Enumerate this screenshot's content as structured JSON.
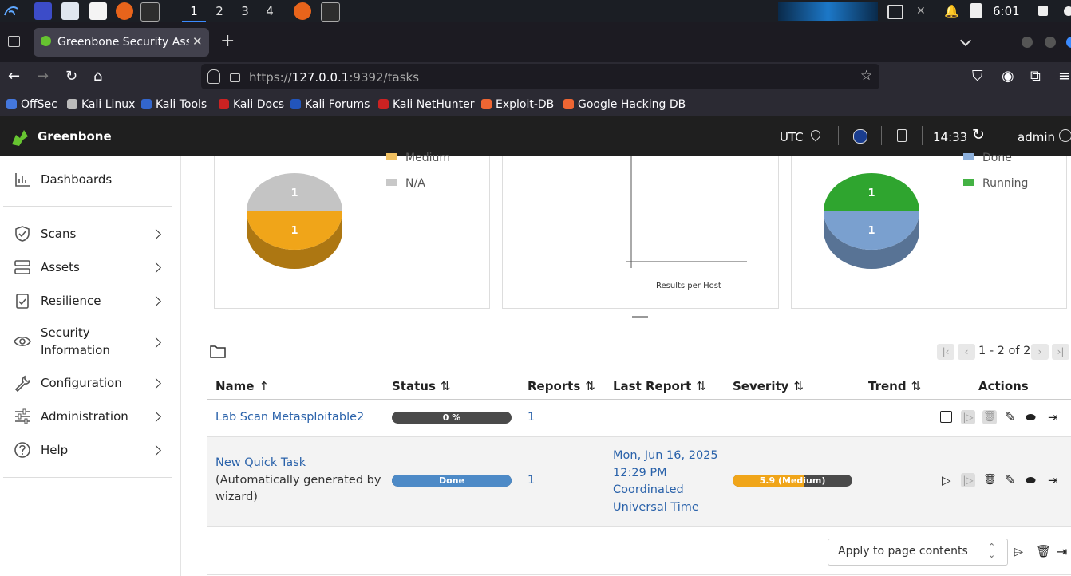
{
  "taskbar": {
    "workspaces": [
      "1",
      "2",
      "3",
      "4"
    ],
    "clock": "6:01"
  },
  "browser": {
    "tab_title": "Greenbone Security Assistant",
    "url_prefix": "https://",
    "url_host": "127.0.0.1",
    "url_rest": ":9392/tasks",
    "bookmarks": [
      "OffSec",
      "Kali Linux",
      "Kali Tools",
      "Kali Docs",
      "Kali Forums",
      "Kali NetHunter",
      "Exploit-DB",
      "Google Hacking DB"
    ]
  },
  "app": {
    "brand": "Greenbone",
    "timezone": "UTC",
    "time": "14:33",
    "user": "admin"
  },
  "sidebar": {
    "items": [
      {
        "label": "Dashboards",
        "icon": "bar-chart-icon"
      },
      {
        "label": "Scans",
        "icon": "shield-icon"
      },
      {
        "label": "Assets",
        "icon": "server-icon"
      },
      {
        "label": "Resilience",
        "icon": "clipboard-check-icon"
      },
      {
        "label": "Security",
        "label2": "Information",
        "icon": "eye-icon"
      },
      {
        "label": "Configuration",
        "icon": "wrench-icon"
      },
      {
        "label": "Administration",
        "icon": "sliders-icon"
      },
      {
        "label": "Help",
        "icon": "help-circle-icon"
      }
    ]
  },
  "chart_data": [
    {
      "type": "pie",
      "legend": [
        "Medium",
        "N/A"
      ],
      "slices": [
        {
          "label": "Medium",
          "value": 1,
          "color": "#f0a519"
        },
        {
          "label": "N/A",
          "value": 1,
          "color": "#c4c4c4"
        }
      ]
    },
    {
      "type": "bar",
      "xlabel": "Results per Host"
    },
    {
      "type": "pie",
      "legend": [
        "Done",
        "Running"
      ],
      "slices": [
        {
          "label": "Done",
          "value": 1,
          "color": "#7aa0cf"
        },
        {
          "label": "Running",
          "value": 1,
          "color": "#2fa52f"
        }
      ]
    }
  ],
  "pagination": {
    "text": "1 - 2 of 2"
  },
  "table": {
    "headers": {
      "name": "Name",
      "status": "Status",
      "reports": "Reports",
      "last_report": "Last Report",
      "severity": "Severity",
      "trend": "Trend",
      "actions": "Actions"
    },
    "rows": [
      {
        "name": "Lab Scan Metasploitable2",
        "status": "0 %",
        "status_progress": 0,
        "reports": "1"
      },
      {
        "name": "New Quick Task",
        "comment_1": "(Automatically generated by",
        "comment_2": "wizard)",
        "status": "Done",
        "status_progress": 100,
        "reports": "1",
        "last_report_1": "Mon, Jun 16, 2025",
        "last_report_2": "12:29 PM",
        "last_report_3": "Coordinated",
        "last_report_4": "Universal Time",
        "severity": "5.9 (Medium)",
        "severity_value": 5.9
      }
    ]
  },
  "footer": {
    "apply_select": "Apply to page contents"
  },
  "colors": {
    "accent_green": "#66c430",
    "link_blue": "#2a62aa",
    "done_blue": "#4d8ac7",
    "medium_orange": "#f0a519"
  }
}
